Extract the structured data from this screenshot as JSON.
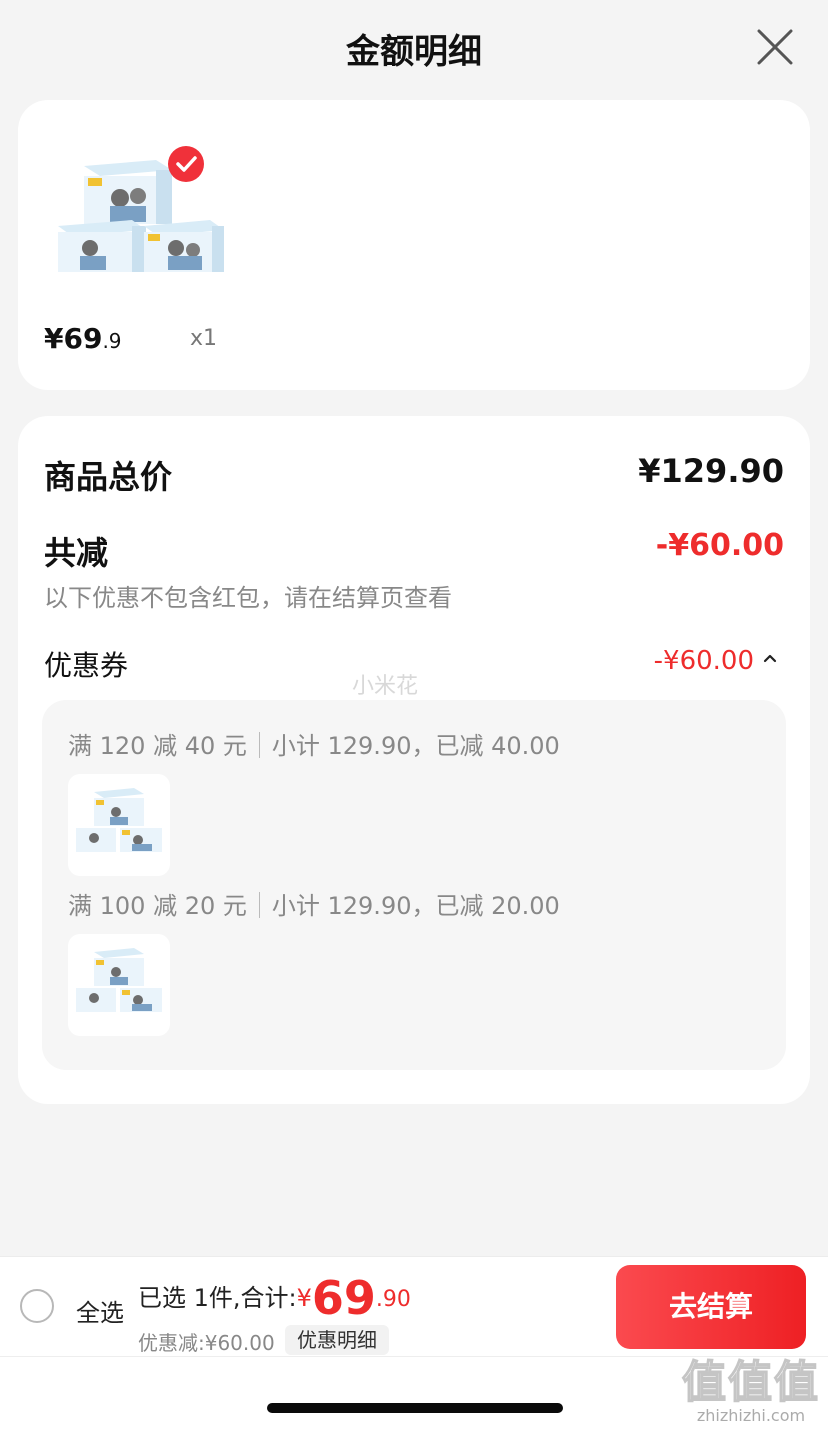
{
  "header": {
    "title": "金额明细",
    "close_icon": "close-icon"
  },
  "product": {
    "price_main": "¥69",
    "price_cents": ".9",
    "quantity": "x1",
    "selected": true,
    "check_icon": "check-icon"
  },
  "summary": {
    "total_label": "商品总价",
    "total_value": "¥129.90",
    "reduce_label": "共减",
    "reduce_value": "-¥60.00",
    "reduce_note": "以下优惠不包含红包，请在结算页查看",
    "coupon_label": "优惠券",
    "coupon_value": "-¥60.00",
    "coupon_toggle_icon": "chevron-up-icon",
    "coupons": [
      {
        "rule": "满 120 减 40 元",
        "detail": "小计 129.90，已减 40.00"
      },
      {
        "rule": "满 100 减 20 元",
        "detail": "小计 129.90，已减 20.00"
      }
    ]
  },
  "watermark_mid": "小米花",
  "bottom": {
    "select_all": "全选",
    "selected_text": "已选 1件,合计:",
    "currency": "¥",
    "total_big": "69",
    "total_small": ".90",
    "discount_text": "优惠减:¥60.00",
    "detail_button": "优惠明细",
    "checkout_button": "去结算"
  },
  "brand_watermark": {
    "zh": "值值值",
    "en": "zhizhizhi.com"
  },
  "colors": {
    "accent_red": "#ee2c2c",
    "checkout_gradient_start": "#fb4a4f",
    "checkout_gradient_end": "#ee2024",
    "page_bg": "#f4f4f4"
  }
}
